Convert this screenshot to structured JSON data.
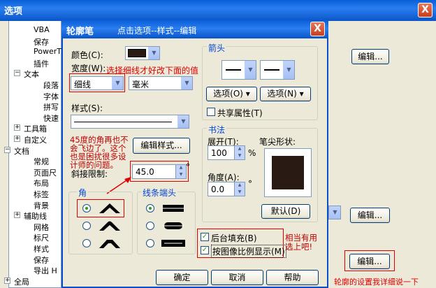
{
  "outer": {
    "title": "选项",
    "close": "X",
    "tree": [
      {
        "label": "VBA",
        "indent": 2
      },
      {
        "label": "保存",
        "indent": 2
      },
      {
        "label": "PowerT",
        "indent": 2
      },
      {
        "label": "插件",
        "indent": 2
      },
      {
        "label": "文本",
        "indent": 1,
        "toggle": "−"
      },
      {
        "label": "段落",
        "indent": 3
      },
      {
        "label": "字体",
        "indent": 3
      },
      {
        "label": "拼写",
        "indent": 3
      },
      {
        "label": "快速",
        "indent": 3
      },
      {
        "label": "工具箱",
        "indent": 1,
        "toggle": "+"
      },
      {
        "label": "自定义",
        "indent": 1,
        "toggle": "+"
      },
      {
        "label": "文档",
        "indent": 0,
        "toggle": "−"
      },
      {
        "label": "常规",
        "indent": 2
      },
      {
        "label": "页面尺",
        "indent": 2
      },
      {
        "label": "布局",
        "indent": 2
      },
      {
        "label": "标签",
        "indent": 2
      },
      {
        "label": "背景",
        "indent": 2
      },
      {
        "label": "辅助线",
        "indent": 1,
        "toggle": "+"
      },
      {
        "label": "网格",
        "indent": 2
      },
      {
        "label": "标尺",
        "indent": 2
      },
      {
        "label": "样式",
        "indent": 2
      },
      {
        "label": "保存",
        "indent": 2
      },
      {
        "label": "导出 H",
        "indent": 2
      },
      {
        "label": "全局",
        "indent": 0,
        "toggle": "+"
      }
    ],
    "edit_button_1": "编辑...",
    "edit_button_2": "编辑...",
    "edit_button_3": "编辑...",
    "note_bottom": "轮廓的设置我详细说一下"
  },
  "dialog": {
    "title": "轮廓笔",
    "subtitle": "点击选项--样式--编辑",
    "close": "X",
    "color_label": "颜色(C):",
    "width_label": "宽度(W):",
    "width_note": "选择细线才好改下面的值",
    "width_value": "细线",
    "unit_value": "毫米",
    "style_label": "样式(S):",
    "edit_style_button": "编辑样式...",
    "corner_note": "45度的角再也不会飞边了。这个也是困扰很多设计师的问题。",
    "miter_label": "斜接限制:",
    "miter_value": "45.0",
    "degree": "°",
    "corners_title": "角",
    "caps_title": "线条端头",
    "arrows_title": "箭头",
    "options_left": "选项(O)",
    "options_right": "选项(N)",
    "share_attr": "共享属性(T)",
    "calligraphy_title": "书法",
    "stretch_label": "展开(T):",
    "stretch_value": "100",
    "percent": "%",
    "angle_label": "角度(A):",
    "angle_value": "0.0",
    "nib_label": "笔尖形状:",
    "default_button": "默认(D)",
    "behind_fill": "后台填充(B)",
    "scale_with_image": "按图像比例显示(M)",
    "useful_note": "相当有用选上吧!",
    "ok": "确定",
    "cancel": "取消",
    "help": "帮助",
    "color_swatch": "#2a1a14",
    "nib_color": "#2a1a14"
  }
}
